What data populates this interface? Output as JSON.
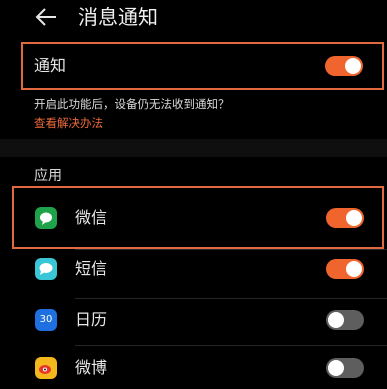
{
  "header": {
    "title": "消息通知",
    "back_icon": "arrow-left-icon"
  },
  "notify": {
    "label": "通知",
    "enabled": true
  },
  "hint": {
    "text": "开启此功能后，设备仍无法收到通知？",
    "link": "查看解决办法"
  },
  "section": {
    "title": "应用"
  },
  "apps": [
    {
      "name": "微信",
      "enabled": true,
      "icon": "wechat-icon",
      "color": "#1fa34a"
    },
    {
      "name": "短信",
      "enabled": true,
      "icon": "sms-icon",
      "color": "#39c6d6"
    },
    {
      "name": "日历",
      "enabled": false,
      "icon": "calendar-icon",
      "color": "#1e6fe0",
      "badge": "30"
    },
    {
      "name": "微博",
      "enabled": false,
      "icon": "weibo-icon",
      "color": "#f3b81d"
    }
  ],
  "colors": {
    "accent": "#f0652d",
    "highlight": "#e2683f",
    "toggle_off": "#5e5e5e"
  }
}
